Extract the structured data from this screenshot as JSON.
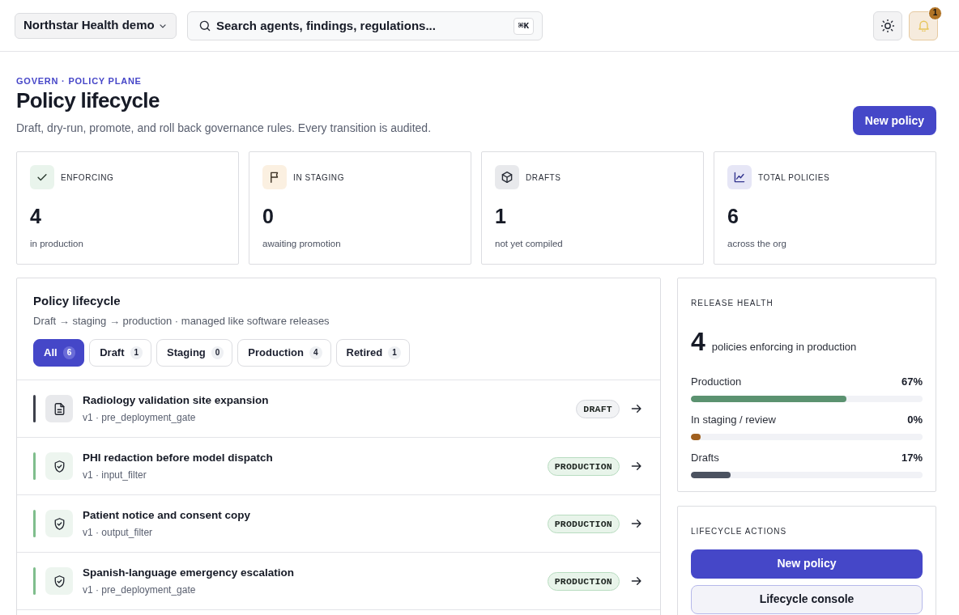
{
  "topbar": {
    "workspace": "Northstar Health demo",
    "search": {
      "placeholder": "Search agents, findings, regulations...",
      "shortcut": "⌘K"
    },
    "notifications": {
      "count": "1"
    }
  },
  "header": {
    "eyebrow": "GOVERN · POLICY PLANE",
    "title": "Policy lifecycle",
    "subtitle": "Draft, dry-run, promote, and roll back governance rules. Every transition is audited.",
    "primary_action": "New policy"
  },
  "stats": [
    {
      "kind": "enforcing",
      "label": "ENFORCING",
      "value": "4",
      "caption": "in production"
    },
    {
      "kind": "staging",
      "label": "IN STAGING",
      "value": "0",
      "caption": "awaiting promotion"
    },
    {
      "kind": "drafts",
      "label": "DRAFTS",
      "value": "1",
      "caption": "not yet compiled"
    },
    {
      "kind": "total",
      "label": "TOTAL POLICIES",
      "value": "6",
      "caption": "across the org"
    }
  ],
  "lifecycle": {
    "title": "Policy lifecycle",
    "subtitle": "Draft → staging → production · managed like software releases",
    "filters": [
      {
        "label": "All",
        "count": "6",
        "selected": true
      },
      {
        "label": "Draft",
        "count": "1",
        "selected": false
      },
      {
        "label": "Staging",
        "count": "0",
        "selected": false
      },
      {
        "label": "Production",
        "count": "4",
        "selected": false
      },
      {
        "label": "Retired",
        "count": "1",
        "selected": false
      }
    ],
    "policies": [
      {
        "kind": "draft",
        "name": "Radiology validation site expansion",
        "meta": "v1 · pre_deployment_gate",
        "badge": "DRAFT"
      },
      {
        "kind": "production",
        "name": "PHI redaction before model dispatch",
        "meta": "v1 · input_filter",
        "badge": "PRODUCTION"
      },
      {
        "kind": "production",
        "name": "Patient notice and consent copy",
        "meta": "v1 · output_filter",
        "badge": "PRODUCTION"
      },
      {
        "kind": "production",
        "name": "Spanish-language emergency escalation",
        "meta": "v1 · pre_deployment_gate",
        "badge": "PRODUCTION"
      }
    ]
  },
  "release_health": {
    "title": "RELEASE HEALTH",
    "count": "4",
    "count_caption": "policies enforcing in production",
    "bars": [
      {
        "label": "Production",
        "reading": "67%",
        "level": 0.67,
        "color": "#5b9270"
      },
      {
        "label": "In staging / review",
        "reading": "0%",
        "level": 0,
        "color": "#a0601f"
      },
      {
        "label": "Drafts",
        "reading": "17%",
        "level": 0.17,
        "color": "#4b5260"
      }
    ]
  },
  "lifecycle_actions": {
    "title": "LIFECYCLE ACTIONS",
    "buttons": [
      {
        "kind": "primary",
        "label": "New policy"
      },
      {
        "kind": "secondary",
        "label": "Lifecycle console"
      }
    ]
  }
}
